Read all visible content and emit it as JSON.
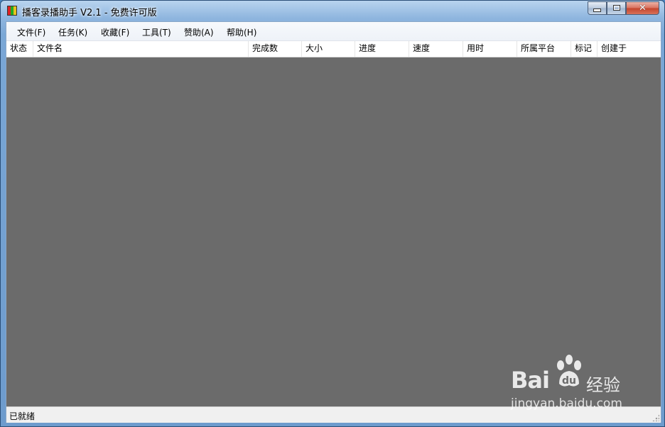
{
  "window": {
    "title": "播客录播助手 V2.1 - 免费许可版"
  },
  "menu": {
    "items": [
      "文件(F)",
      "任务(K)",
      "收藏(F)",
      "工具(T)",
      "赞助(A)",
      "帮助(H)"
    ]
  },
  "list": {
    "columns": [
      "状态",
      "文件名",
      "完成数",
      "大小",
      "进度",
      "速度",
      "用时",
      "所属平台",
      "标记",
      "创建于"
    ],
    "rows": []
  },
  "statusbar": {
    "text": "已就绪"
  },
  "watermark": {
    "logo": "Bai",
    "logo_suffix": "经验",
    "url": "jingyan.baidu.com"
  },
  "icons": {
    "app": "app-icon",
    "minimize": "minimize-icon",
    "maximize": "maximize-icon",
    "close": "close-icon",
    "grip": "resize-grip-icon"
  },
  "colors": {
    "list_background": "#6b6b6b",
    "titlebar": "#7aa7d6"
  }
}
